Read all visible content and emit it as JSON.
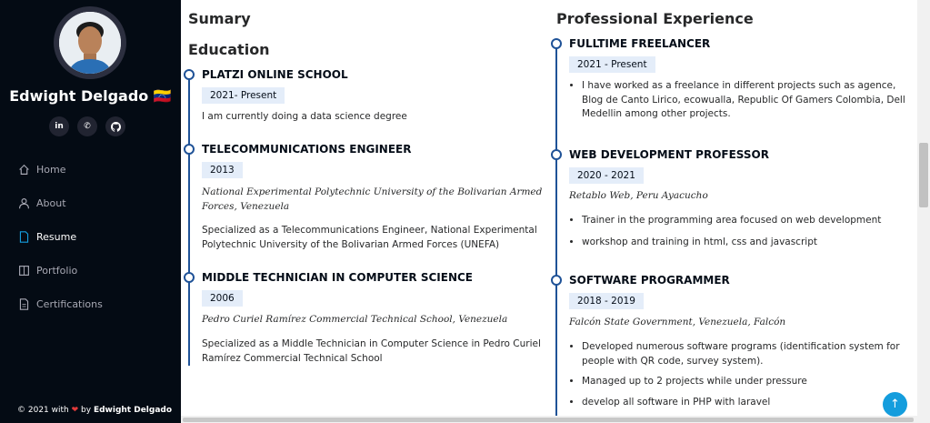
{
  "sidebar": {
    "name": "Edwight Delgado",
    "flag": "🇻🇪",
    "socials": [
      {
        "icon": "linkedin-icon",
        "label": "in"
      },
      {
        "icon": "whatsapp-icon",
        "label": "✆"
      },
      {
        "icon": "github-icon",
        "label": "●"
      }
    ],
    "nav": [
      {
        "label": "Home",
        "icon": "home-icon",
        "active": false
      },
      {
        "label": "About",
        "icon": "user-icon",
        "active": false
      },
      {
        "label": "Resume",
        "icon": "file-icon",
        "active": true
      },
      {
        "label": "Portfolio",
        "icon": "book-icon",
        "active": false
      },
      {
        "label": "Certifications",
        "icon": "certificate-icon",
        "active": false
      }
    ],
    "footer": {
      "prefix": "© 2021 with",
      "by": "by",
      "author": "Edwight Delgado"
    }
  },
  "resume": {
    "summary_title": "Sumary",
    "education_title": "Education",
    "experience_title": "Professional Experience",
    "education": [
      {
        "title": "PLATZI ONLINE SCHOOL",
        "date": "2021- Present",
        "text": "I am currently doing a data science degree"
      },
      {
        "title": "TELECOMMUNICATIONS ENGINEER",
        "date": "2013",
        "institution": "National Experimental Polytechnic University of the Bolivarian Armed Forces, Venezuela",
        "text": "Specialized as a Telecommunications Engineer, National Experimental Polytechnic University of the Bolivarian Armed Forces (UNEFA)"
      },
      {
        "title": "MIDDLE TECHNICIAN IN COMPUTER SCIENCE",
        "date": "2006",
        "institution": "Pedro Curiel Ramírez Commercial Technical School, Venezuela",
        "text": "Specialized as a Middle Technician in Computer Science in Pedro Curiel Ramírez Commercial Technical School"
      }
    ],
    "experience": [
      {
        "title": "FULLTIME FREELANCER",
        "date": "2021 - Present",
        "bullets": [
          "I have worked as a freelance in different projects such as agence, Blog de Canto Lirico, ecowualla, Republic Of Gamers Colombia, Dell Medellin among other projects."
        ]
      },
      {
        "title": "WEB DEVELOPMENT PROFESSOR",
        "date": "2020 - 2021",
        "institution": "Retablo Web, Peru Ayacucho",
        "bullets": [
          "Trainer in the programming area focused on web development",
          "workshop and training in html, css and javascript"
        ]
      },
      {
        "title": "SOFTWARE PROGRAMMER",
        "date": "2018 - 2019",
        "institution": "Falcón State Government, Venezuela, Falcón",
        "bullets": [
          "Developed numerous software programs (identification system for people with QR code, survey system).",
          "Managed up to 2 projects while under pressure",
          "develop all software in PHP with laravel"
        ]
      }
    ]
  },
  "back_to_top": "↑",
  "colors": {
    "sidebar_bg": "#040b14",
    "accent": "#149ddd",
    "timeline": "#1f5297",
    "date_bg": "#e4edf9"
  }
}
